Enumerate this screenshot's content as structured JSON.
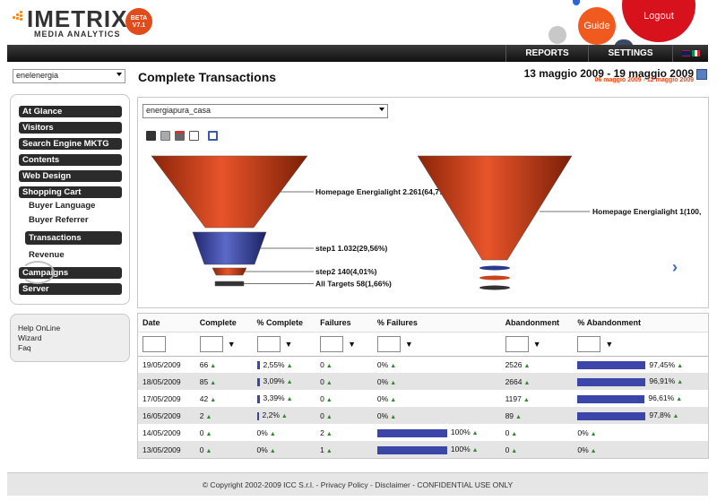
{
  "header": {
    "brand": "IMETRIX",
    "subtitle": "MEDIA ANALYTICS",
    "badge_line1": "BETA",
    "badge_line2": "V7.1",
    "guide": "Guide",
    "logout": "Logout"
  },
  "topnav": {
    "reports": "REPORTS",
    "settings": "SETTINGS"
  },
  "client_select": {
    "value": "enelenergia"
  },
  "menu": {
    "items": [
      "At Glance",
      "Visitors",
      "Search Engine MKTG",
      "Contents",
      "Web Design",
      "Shopping Cart"
    ],
    "sub_items": [
      "Buyer Language",
      "Buyer Referrer",
      "Transactions",
      "Revenue"
    ],
    "bottom_items": [
      "Campaigns",
      "Server"
    ]
  },
  "help": {
    "items": [
      "Help OnLine",
      "Wizard",
      "Faq"
    ]
  },
  "page": {
    "title": "Complete Transactions",
    "date_range": "13 maggio 2009 - 19 maggio 2009",
    "date_compare": "06 maggio 2009 - 12 maggio 2009",
    "page_select": "energiapura_casa"
  },
  "funnels": [
    {
      "steps": [
        {
          "label": "Homepage Energialight 2.261(64,77%",
          "value": 2261
        },
        {
          "label": "step1 1.032(29,56%)",
          "value": 1032
        },
        {
          "label": "step2 140(4,01%)",
          "value": 140
        },
        {
          "label": "All Targets 58(1,66%)",
          "value": 58
        }
      ]
    },
    {
      "steps": [
        {
          "label": "Homepage Energialight 1(100,",
          "value": 1
        }
      ]
    }
  ],
  "table": {
    "columns": [
      "Date",
      "Complete",
      "% Complete",
      "Failures",
      "% Failures",
      "Abandonment",
      "% Abandonment"
    ],
    "rows": [
      {
        "date": "19/05/2009",
        "complete": "66",
        "pct_complete": "2,55%",
        "failures": "0",
        "pct_failures": "0%",
        "abandonment": "2526",
        "pct_abandonment": "97,45%"
      },
      {
        "date": "18/05/2009",
        "complete": "85",
        "pct_complete": "3,09%",
        "failures": "0",
        "pct_failures": "0%",
        "abandonment": "2664",
        "pct_abandonment": "96,91%"
      },
      {
        "date": "17/05/2009",
        "complete": "42",
        "pct_complete": "3,39%",
        "failures": "0",
        "pct_failures": "0%",
        "abandonment": "1197",
        "pct_abandonment": "96,61%"
      },
      {
        "date": "16/05/2009",
        "complete": "2",
        "pct_complete": "2,2%",
        "failures": "0",
        "pct_failures": "0%",
        "abandonment": "89",
        "pct_abandonment": "97,8%"
      },
      {
        "date": "14/05/2009",
        "complete": "0",
        "pct_complete": "0%",
        "failures": "2",
        "pct_failures": "100%",
        "abandonment": "0",
        "pct_abandonment": "0%"
      },
      {
        "date": "13/05/2009",
        "complete": "0",
        "pct_complete": "0%",
        "failures": "1",
        "pct_failures": "100%",
        "abandonment": "0",
        "pct_abandonment": "0%"
      }
    ]
  },
  "footer": {
    "text": "© Copyright 2002-2009 ICC S.r.l. - Privacy Policy - Disclaimer - CONFIDENTIAL USE ONLY"
  },
  "colors": {
    "accent_orange": "#f05a1e",
    "logout_red": "#d8121d",
    "bar_blue": "#3b46a8",
    "funnel_orange": "#d9481c",
    "funnel_blue": "#3a47a8"
  }
}
